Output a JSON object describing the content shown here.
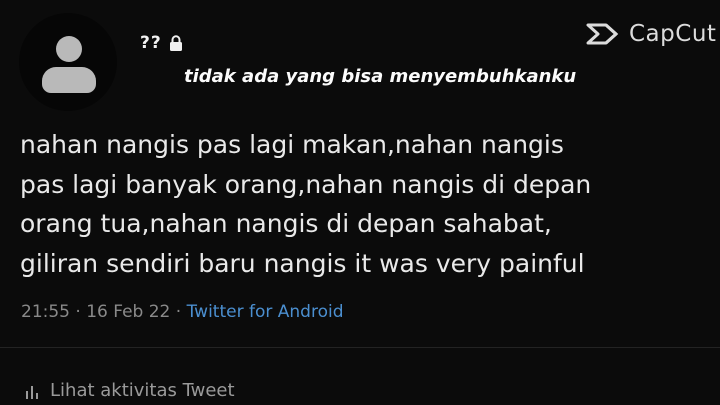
{
  "profile": {
    "name": "??",
    "bio": "tidak ada yang bisa menyembuhkanku"
  },
  "watermark": {
    "text": "CapCut"
  },
  "tweet": {
    "lines": [
      "nahan nangis pas lagi makan,nahan nangis",
      "pas lagi banyak orang,nahan nangis di depan",
      "orang tua,nahan nangis di depan sahabat,",
      "giliran sendiri baru nangis it was very painful"
    ],
    "timestamp": "21:55 · 16 Feb 22 · ",
    "source": "Twitter for Android"
  },
  "actions": {
    "activity_label": "Lihat aktivitas Tweet"
  },
  "colors": {
    "background": "#0b0b0b",
    "link": "#4b8fd0",
    "meta": "#8a8a8a"
  },
  "icons": [
    "default-avatar-icon",
    "lock-icon",
    "capcut-icon",
    "bar-chart-icon"
  ]
}
